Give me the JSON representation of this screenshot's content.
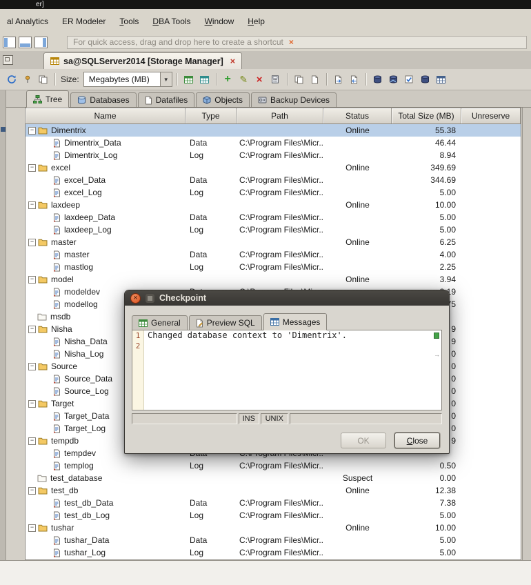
{
  "window": {
    "title_fragment": "er]"
  },
  "menubar": {
    "items": [
      {
        "label": "al Analytics"
      },
      {
        "label": "ER Modeler"
      },
      {
        "label": "Tools"
      },
      {
        "label": "DBA Tools"
      },
      {
        "label": "Window"
      },
      {
        "label": "Help"
      }
    ]
  },
  "quickbar": {
    "hint": "For quick access, drag and drop here to create a shortcut"
  },
  "doc_tab": {
    "label": "sa@SQLServer2014 [Storage Manager]"
  },
  "toolbar": {
    "size_label": "Size:",
    "size_value": "Megabytes (MB)"
  },
  "view_tabs": [
    {
      "label": "Tree"
    },
    {
      "label": "Databases"
    },
    {
      "label": "Datafiles"
    },
    {
      "label": "Objects"
    },
    {
      "label": "Backup Devices"
    }
  ],
  "table": {
    "columns": [
      "Name",
      "Type",
      "Path",
      "Status",
      "Total Size (MB)",
      "Unreserve"
    ],
    "rows": [
      {
        "name": "Dimentrix",
        "level": 0,
        "icon": "folder",
        "expander": true,
        "type": "",
        "path": "",
        "status": "Online",
        "size": "55.38",
        "selected": true
      },
      {
        "name": "Dimentrix_Data",
        "level": 1,
        "icon": "file",
        "type": "Data",
        "path": "C:\\Program Files\\Micr...",
        "status": "",
        "size": "46.44"
      },
      {
        "name": "Dimentrix_Log",
        "level": 1,
        "icon": "file",
        "type": "Log",
        "path": "C:\\Program Files\\Micr...",
        "status": "",
        "size": "8.94"
      },
      {
        "name": "excel",
        "level": 0,
        "icon": "folder",
        "expander": true,
        "type": "",
        "path": "",
        "status": "Online",
        "size": "349.69"
      },
      {
        "name": "excel_Data",
        "level": 1,
        "icon": "file",
        "type": "Data",
        "path": "C:\\Program Files\\Micr...",
        "status": "",
        "size": "344.69"
      },
      {
        "name": "excel_Log",
        "level": 1,
        "icon": "file",
        "type": "Log",
        "path": "C:\\Program Files\\Micr...",
        "status": "",
        "size": "5.00"
      },
      {
        "name": "laxdeep",
        "level": 0,
        "icon": "folder",
        "expander": true,
        "type": "",
        "path": "",
        "status": "Online",
        "size": "10.00"
      },
      {
        "name": "laxdeep_Data",
        "level": 1,
        "icon": "file",
        "type": "Data",
        "path": "C:\\Program Files\\Micr...",
        "status": "",
        "size": "5.00"
      },
      {
        "name": "laxdeep_Log",
        "level": 1,
        "icon": "file",
        "type": "Log",
        "path": "C:\\Program Files\\Micr...",
        "status": "",
        "size": "5.00"
      },
      {
        "name": "master",
        "level": 0,
        "icon": "folder",
        "expander": true,
        "type": "",
        "path": "",
        "status": "Online",
        "size": "6.25"
      },
      {
        "name": "master",
        "level": 1,
        "icon": "file",
        "type": "Data",
        "path": "C:\\Program Files\\Micr...",
        "status": "",
        "size": "4.00"
      },
      {
        "name": "mastlog",
        "level": 1,
        "icon": "file",
        "type": "Log",
        "path": "C:\\Program Files\\Micr...",
        "status": "",
        "size": "2.25"
      },
      {
        "name": "model",
        "level": 0,
        "icon": "folder",
        "expander": true,
        "type": "",
        "path": "",
        "status": "Online",
        "size": "3.94"
      },
      {
        "name": "modeldev",
        "level": 1,
        "icon": "file",
        "type": "Data",
        "path": "C:\\Program Files\\Micr...",
        "status": "",
        "size": "3.19"
      },
      {
        "name": "modellog",
        "level": 1,
        "icon": "file",
        "type": "",
        "path": "",
        "status": "",
        "size": "0.75"
      },
      {
        "name": "msdb",
        "level": 0,
        "icon": "folder-plain",
        "expander": false,
        "type": "",
        "path": "",
        "status": "",
        "size": ""
      },
      {
        "name": "Nisha",
        "level": 0,
        "icon": "folder",
        "expander": true,
        "type": "",
        "path": "",
        "status": "",
        "size": "9"
      },
      {
        "name": "Nisha_Data",
        "level": 1,
        "icon": "file",
        "type": "",
        "path": "",
        "status": "",
        "size": "9"
      },
      {
        "name": "Nisha_Log",
        "level": 1,
        "icon": "file",
        "type": "",
        "path": "",
        "status": "",
        "size": "0"
      },
      {
        "name": "Source",
        "level": 0,
        "icon": "folder",
        "expander": true,
        "type": "",
        "path": "",
        "status": "",
        "size": "0"
      },
      {
        "name": "Source_Data",
        "level": 1,
        "icon": "file",
        "type": "",
        "path": "",
        "status": "",
        "size": "0"
      },
      {
        "name": "Source_Log",
        "level": 1,
        "icon": "file",
        "type": "",
        "path": "",
        "status": "",
        "size": "0"
      },
      {
        "name": "Target",
        "level": 0,
        "icon": "folder",
        "expander": true,
        "type": "",
        "path": "",
        "status": "",
        "size": "0"
      },
      {
        "name": "Target_Data",
        "level": 1,
        "icon": "file",
        "type": "",
        "path": "",
        "status": "",
        "size": "0"
      },
      {
        "name": "Target_Log",
        "level": 1,
        "icon": "file",
        "type": "",
        "path": "",
        "status": "",
        "size": "0"
      },
      {
        "name": "tempdb",
        "level": 0,
        "icon": "folder",
        "expander": true,
        "type": "",
        "path": "",
        "status": "",
        "size": "9"
      },
      {
        "name": "tempdev",
        "level": 1,
        "icon": "file",
        "type": "Data",
        "path": "C:\\Program Files\\Micr...",
        "status": "",
        "size": ""
      },
      {
        "name": "templog",
        "level": 1,
        "icon": "file",
        "type": "Log",
        "path": "C:\\Program Files\\Micr...",
        "status": "",
        "size": "0.50"
      },
      {
        "name": "test_database",
        "level": 0,
        "icon": "folder-plain",
        "expander": false,
        "type": "",
        "path": "",
        "status": "Suspect",
        "size": "0.00"
      },
      {
        "name": "test_db",
        "level": 0,
        "icon": "folder",
        "expander": true,
        "type": "",
        "path": "",
        "status": "Online",
        "size": "12.38"
      },
      {
        "name": "test_db_Data",
        "level": 1,
        "icon": "file",
        "type": "Data",
        "path": "C:\\Program Files\\Micr...",
        "status": "",
        "size": "7.38"
      },
      {
        "name": "test_db_Log",
        "level": 1,
        "icon": "file",
        "type": "Log",
        "path": "C:\\Program Files\\Micr...",
        "status": "",
        "size": "5.00"
      },
      {
        "name": "tushar",
        "level": 0,
        "icon": "folder",
        "expander": true,
        "type": "",
        "path": "",
        "status": "Online",
        "size": "10.00"
      },
      {
        "name": "tushar_Data",
        "level": 1,
        "icon": "file",
        "type": "Data",
        "path": "C:\\Program Files\\Micr...",
        "status": "",
        "size": "5.00"
      },
      {
        "name": "tushar_Log",
        "level": 1,
        "icon": "file",
        "type": "Log",
        "path": "C:\\Program Files\\Micr...",
        "status": "",
        "size": "5.00"
      }
    ]
  },
  "dialog": {
    "title": "Checkpoint",
    "tabs": [
      {
        "label": "General"
      },
      {
        "label": "Preview SQL"
      },
      {
        "label": "Messages"
      }
    ],
    "line_numbers": [
      "1",
      "2"
    ],
    "message": "Changed database context to 'Dimentrix'.",
    "status_cells": {
      "ins": "INS",
      "unix": "UNIX"
    },
    "buttons": {
      "ok": "OK",
      "close": "Close"
    }
  },
  "icons": {
    "close": "×",
    "dropdown_arrow": "▼",
    "expander_collapse": "−",
    "add": "+",
    "edit": "✎",
    "delete": "×",
    "cursor_arrow": "→"
  },
  "colors": {
    "selection": "#b9cfe8",
    "dialog_titlebar": "#3a3835",
    "close_button": "#e2572b",
    "marker_green": "#44a248",
    "status_suspect_size": "#000000"
  }
}
